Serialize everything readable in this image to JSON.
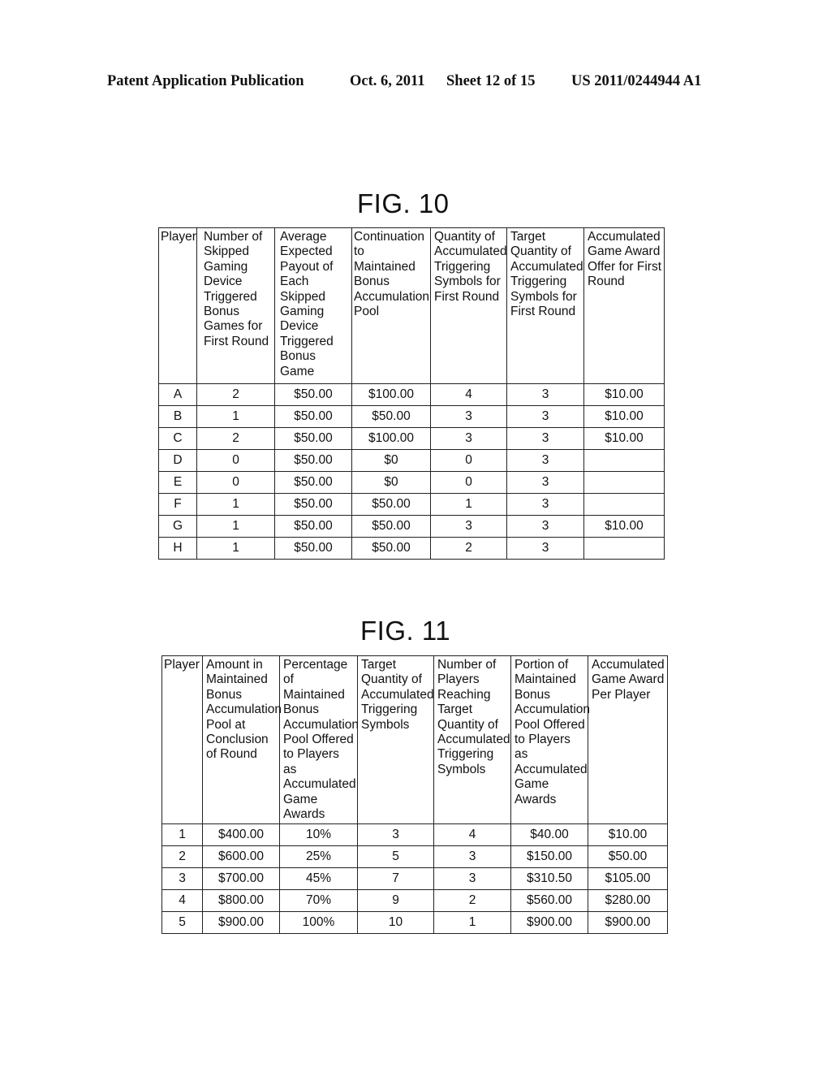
{
  "header": {
    "publication": "Patent Application Publication",
    "date": "Oct. 6, 2011",
    "sheet": "Sheet 12 of 15",
    "number": "US 2011/0244944 A1"
  },
  "fig10": {
    "title": "FIG. 10",
    "columns": [
      "Player",
      "Number of Skipped Gaming Device Triggered Bonus Games for First Round",
      "Average Expected Payout of Each Skipped Gaming Device Triggered Bonus Game",
      "Continuation to Maintained Bonus Accumulation Pool",
      "Quantity of Accumulated Triggering Symbols for First Round",
      "Target Quantity of Accumulated Triggering Symbols for First Round",
      "Accumulated Game Award Offer for First Round"
    ],
    "rows": [
      [
        "A",
        "2",
        "$50.00",
        "$100.00",
        "4",
        "3",
        "$10.00"
      ],
      [
        "B",
        "1",
        "$50.00",
        "$50.00",
        "3",
        "3",
        "$10.00"
      ],
      [
        "C",
        "2",
        "$50.00",
        "$100.00",
        "3",
        "3",
        "$10.00"
      ],
      [
        "D",
        "0",
        "$50.00",
        "$0",
        "0",
        "3",
        ""
      ],
      [
        "E",
        "0",
        "$50.00",
        "$0",
        "0",
        "3",
        ""
      ],
      [
        "F",
        "1",
        "$50.00",
        "$50.00",
        "1",
        "3",
        ""
      ],
      [
        "G",
        "1",
        "$50.00",
        "$50.00",
        "3",
        "3",
        "$10.00"
      ],
      [
        "H",
        "1",
        "$50.00",
        "$50.00",
        "2",
        "3",
        ""
      ]
    ]
  },
  "fig11": {
    "title": "FIG. 11",
    "columns": [
      "Player",
      "Amount in Maintained Bonus Accumulation Pool at Conclusion of Round",
      "Percentage of Maintained Bonus Accumulation Pool Offered to Players as Accumulated Game Awards",
      "Target Quantity of Accumulated Triggering Symbols",
      "Number of Players Reaching Target Quantity of Accumulated Triggering Symbols",
      "Portion of Maintained Bonus Accumulation Pool Offered to Players as Accumulated Game Awards",
      "Accumulated Game Award Per Player"
    ],
    "rows": [
      [
        "1",
        "$400.00",
        "10%",
        "3",
        "4",
        "$40.00",
        "$10.00"
      ],
      [
        "2",
        "$600.00",
        "25%",
        "5",
        "3",
        "$150.00",
        "$50.00"
      ],
      [
        "3",
        "$700.00",
        "45%",
        "7",
        "3",
        "$310.50",
        "$105.00"
      ],
      [
        "4",
        "$800.00",
        "70%",
        "9",
        "2",
        "$560.00",
        "$280.00"
      ],
      [
        "5",
        "$900.00",
        "100%",
        "10",
        "1",
        "$900.00",
        "$900.00"
      ]
    ]
  }
}
